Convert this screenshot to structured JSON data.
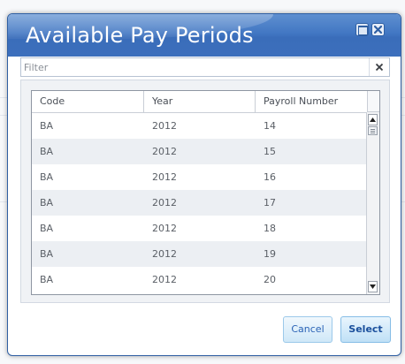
{
  "dialog": {
    "title": "Available Pay Periods",
    "maximize_icon": "maximize-icon",
    "close_icon": "close-icon"
  },
  "filter": {
    "placeholder": "Filter",
    "value": "",
    "clear_icon": "x-icon"
  },
  "grid": {
    "columns": [
      "Code",
      "Year",
      "Payroll Number"
    ],
    "rows": [
      [
        "BA",
        "2012",
        "14"
      ],
      [
        "BA",
        "2012",
        "15"
      ],
      [
        "BA",
        "2012",
        "16"
      ],
      [
        "BA",
        "2012",
        "17"
      ],
      [
        "BA",
        "2012",
        "18"
      ],
      [
        "BA",
        "2012",
        "19"
      ],
      [
        "BA",
        "2012",
        "20"
      ]
    ]
  },
  "buttons": {
    "cancel": "Cancel",
    "select": "Select"
  },
  "colors": {
    "titlebar": "#4277c3",
    "accent": "#2b63b6"
  }
}
